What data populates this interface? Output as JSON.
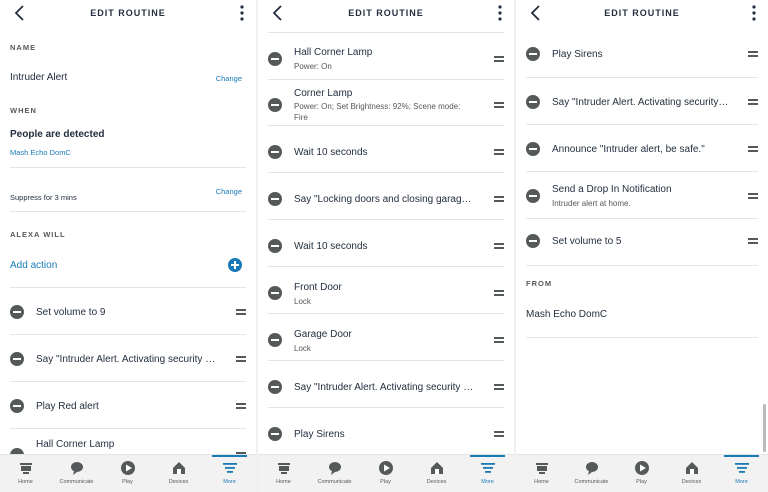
{
  "colors": {
    "accent": "#1a7ab8",
    "text": "#232f3e",
    "muted": "#565959",
    "divider": "#e3e6e6",
    "nav_bg": "#f2f2f2"
  },
  "header": {
    "title": "EDIT ROUTINE",
    "back_icon": "chevron-left-icon",
    "menu_icon": "more-vertical-icon"
  },
  "screen1": {
    "name_label": "NAME",
    "name_value": "Intruder Alert",
    "name_change": "Change",
    "when_label": "WHEN",
    "trigger_title": "People are detected",
    "trigger_device": "Mash Echo DomC",
    "suppress": "Suppress for 3 mins",
    "suppress_change": "Change",
    "alexa_label": "ALEXA WILL",
    "add_action": "Add action",
    "actions": [
      {
        "title": "Set volume to 9"
      },
      {
        "title": "Say \"Intruder Alert. Activating security protocol\""
      },
      {
        "title": "Play Red alert"
      },
      {
        "title": "Hall Corner Lamp"
      }
    ]
  },
  "screen2": {
    "actions": [
      {
        "title": "Hall Corner Lamp",
        "sub": "Power: On"
      },
      {
        "title": "Corner Lamp",
        "sub": "Power: On; Set Brightness: 92%; Scene mode: Fire"
      },
      {
        "title": "Wait 10 seconds",
        "sub": ""
      },
      {
        "title": "Say \"Locking doors and closing garage door\"",
        "sub": ""
      },
      {
        "title": "Wait 10 seconds",
        "sub": ""
      },
      {
        "title": "Front Door",
        "sub": "Lock"
      },
      {
        "title": "Garage Door",
        "sub": "Lock"
      },
      {
        "title": "Say \"Intruder Alert. Activating security protocol\"",
        "sub": ""
      },
      {
        "title": "Play Sirens",
        "sub": ""
      }
    ]
  },
  "screen3": {
    "actions": [
      {
        "title": "Play Sirens",
        "sub": ""
      },
      {
        "title": "Say \"Intruder Alert. Activating security protocol\"",
        "sub": ""
      },
      {
        "title": "Announce \"Intruder alert, be safe.\"",
        "sub": ""
      },
      {
        "title": "Send a Drop In Notification",
        "sub": "Intruder alert at home."
      },
      {
        "title": "Set volume to 5",
        "sub": ""
      }
    ],
    "from_label": "FROM",
    "from_device": "Mash Echo DomC"
  },
  "nav": {
    "items": [
      {
        "label": "Home",
        "icon": "home-icon"
      },
      {
        "label": "Communicate",
        "icon": "chat-icon"
      },
      {
        "label": "Play",
        "icon": "play-icon"
      },
      {
        "label": "Devices",
        "icon": "devices-icon"
      },
      {
        "label": "More",
        "icon": "menu-icon",
        "active": true
      }
    ]
  }
}
